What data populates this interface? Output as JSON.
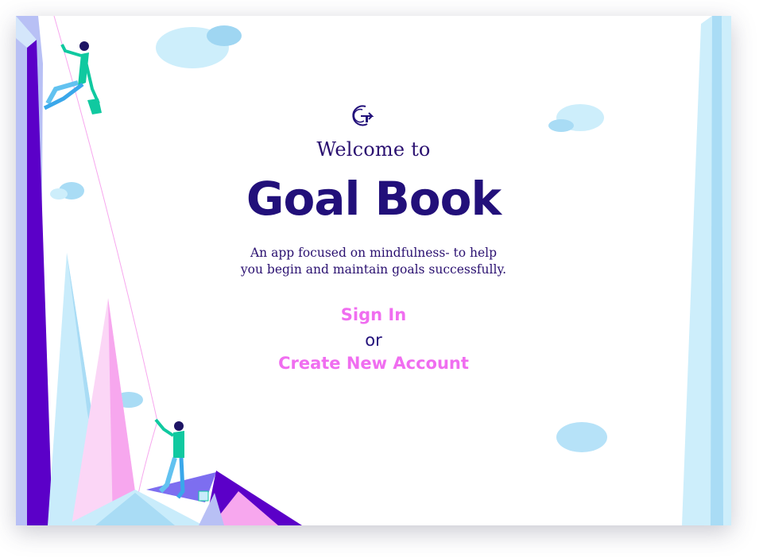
{
  "logo": {
    "icon": "goal-book-logo-icon"
  },
  "header": {
    "welcome_text": "Welcome to",
    "app_name": "Goal Book"
  },
  "tagline": {
    "line1": "An app focused on mindfulness- to help",
    "line2": "you begin and maintain goals successfully."
  },
  "auth": {
    "sign_in_label": "Sign In",
    "separator_text": "or",
    "create_account_label": "Create New Account"
  },
  "colors": {
    "primary_text": "#22107a",
    "link": "#f06ef0",
    "purple_cliff": "#5b00c8",
    "light_blue": "#c9ecfb",
    "pink": "#f7a7ee"
  }
}
